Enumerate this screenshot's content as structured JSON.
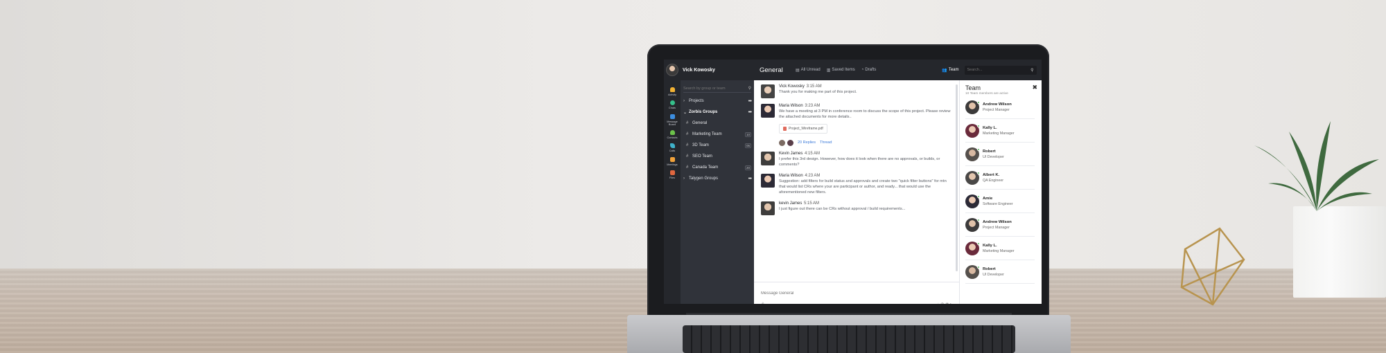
{
  "app": {
    "user_name": "Vick Kowosky",
    "channel_title": "General",
    "filters": [
      {
        "label": "All Unread",
        "icon": "unread-icon"
      },
      {
        "label": "Saved Items",
        "icon": "bookmark-icon"
      },
      {
        "label": "Drafts",
        "icon": "drafts-icon"
      }
    ],
    "team_toggle": "Team",
    "search_placeholder": "Search..."
  },
  "rail": [
    {
      "label": "Activity",
      "icon": "bell-icon",
      "color": "#f2b233"
    },
    {
      "label": "Chats",
      "icon": "chat-icon",
      "color": "#35c08b"
    },
    {
      "label": "Message Board",
      "icon": "message-board-icon",
      "color": "#3c8ee0"
    },
    {
      "label": "Contacts",
      "icon": "contacts-icon",
      "color": "#6cc24a"
    },
    {
      "label": "Calls",
      "icon": "phone-icon",
      "color": "#3fb1c9"
    },
    {
      "label": "Meetings",
      "icon": "calendar-icon",
      "color": "#f2a23a"
    },
    {
      "label": "Files",
      "icon": "files-icon",
      "color": "#e0673f"
    }
  ],
  "channels": {
    "search_placeholder": "Search by group or team",
    "projects_label": "Projects",
    "zorbis_label": "Zorbis Groups",
    "items": [
      {
        "label": "General",
        "badge": ""
      },
      {
        "label": "Marketing Team",
        "badge": "10"
      },
      {
        "label": "3D Team",
        "badge": "05"
      },
      {
        "label": "SEO Team",
        "badge": ""
      },
      {
        "label": "Canada Team",
        "badge": "20"
      }
    ],
    "talygen_label": "Talygen Groups"
  },
  "messages": [
    {
      "author": "Vick Kowosky",
      "time": "3:15 AM",
      "text": "Thank you for making me part of this project."
    },
    {
      "author": "Maria Wilson",
      "time": "3:23 AM",
      "text": "We have a meeting at 3 PM in conference room to discuss the scope of this project. Please review the attached documents for more details..",
      "attachment": "Project_Wireframe.pdf",
      "replies": "20 Replies",
      "thread": "Thread"
    },
    {
      "author": "Kevin James",
      "time": "4:15 AM",
      "text": "I prefer this 3rd design. However, how does it look when there are no approvals, or builds, or comments?"
    },
    {
      "author": "Maria Wilson",
      "time": "4:23 AM",
      "text": "Suggestion: add filters for build status and approvals and create two \"quick filter buttons\" for mtn that would list CRs where your are participant or author, and ready... that would use the aforementioned new filters."
    },
    {
      "author": "kevin James",
      "time": "5:15 AM",
      "text": "I just figure out there can be CRs without approval / build requirements..."
    }
  ],
  "composer_placeholder": "Message General",
  "team": {
    "title": "Team",
    "subtitle": "10 Team members are active",
    "members": [
      {
        "name": "Andrew Wilson",
        "role": "Project Manager"
      },
      {
        "name": "Kally L.",
        "role": "Marketing Manager"
      },
      {
        "name": "Robert",
        "role": "UI Developer"
      },
      {
        "name": "Albert K.",
        "role": "QA Engineer"
      },
      {
        "name": "Amie",
        "role": "Software Engineer"
      },
      {
        "name": "Andrew Wilson",
        "role": "Project Manager"
      },
      {
        "name": "Kally L.",
        "role": "Marketing Manager"
      },
      {
        "name": "Robert",
        "role": "UI Developer"
      }
    ]
  }
}
